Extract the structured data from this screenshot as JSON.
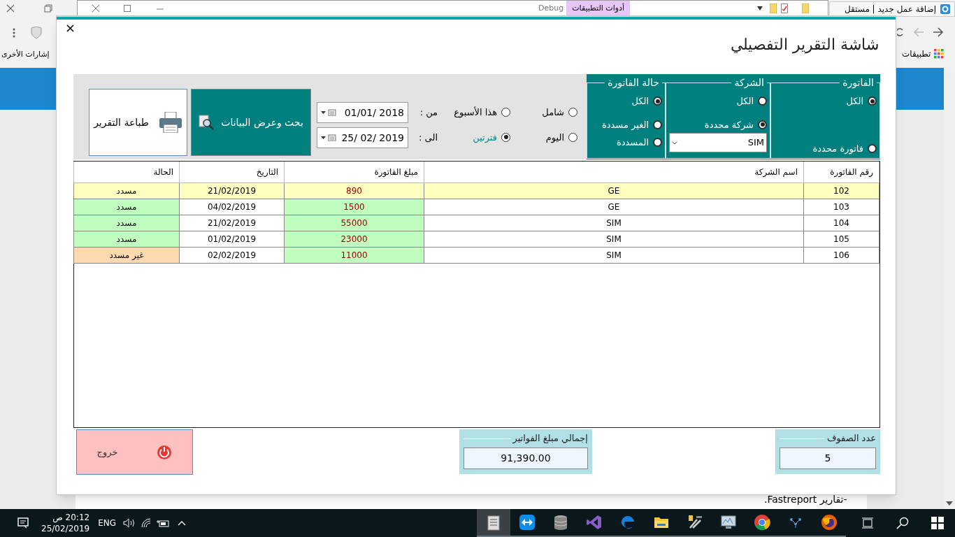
{
  "browser": {
    "tab_title": "إضافة عمل جديد | مستقل",
    "bookmarks": [
      {
        "label": "تطبيقات"
      },
      {
        "label": "إشارات الأخرى"
      }
    ]
  },
  "word": {
    "context_tab": "أدوات التطبيقات",
    "mode": "Debug",
    "document_text": "-تقارير Fastreport."
  },
  "dialog": {
    "title": "شاشة التقرير التفصيلي",
    "filter_groups": [
      {
        "title": "الفاتورة",
        "options": [
          {
            "label": "الكل",
            "selected": true
          },
          {
            "label": "فاتورة محددة",
            "selected": false
          }
        ]
      },
      {
        "title": "الشركة",
        "options": [
          {
            "label": "الكل",
            "selected": false
          },
          {
            "label": "شركة محددة",
            "selected": true
          }
        ],
        "dropdown": {
          "value": "SIM"
        }
      },
      {
        "title": "حالة الفاتورة",
        "options": [
          {
            "label": "الكل",
            "selected": true
          },
          {
            "label": "الغير مسددة",
            "selected": false
          },
          {
            "label": "المسددة",
            "selected": false
          }
        ]
      }
    ],
    "period_options": [
      {
        "label": "شامل",
        "selected": false
      },
      {
        "label": "هذا الأسبوع",
        "selected": false
      },
      {
        "label": "اليوم",
        "selected": false
      },
      {
        "label": "فترتين",
        "selected": true
      }
    ],
    "date_from": {
      "label": "من :",
      "value": "01/01/ 2018"
    },
    "date_to": {
      "label": "الى :",
      "value": "25/ 02/ 2019"
    },
    "search_button": "بحث وعرض البيانات",
    "print_button": "طباعة التقرير",
    "table": {
      "columns": [
        "رقم الفاتورة",
        "اسم الشركة",
        "مبلغ الفاتورة",
        "التاريخ",
        "الحالة"
      ],
      "rows": [
        {
          "cells": [
            "102",
            "GE",
            "890",
            "21/02/2019",
            "مسدد"
          ],
          "selected": true
        },
        {
          "cells": [
            "103",
            "GE",
            "1500",
            "04/02/2019",
            "مسدد"
          ],
          "selected": false,
          "color": "#c0ffc0"
        },
        {
          "cells": [
            "104",
            "SIM",
            "55000",
            "21/02/2019",
            "مسدد"
          ],
          "selected": false,
          "color": "#c0ffc0"
        },
        {
          "cells": [
            "105",
            "SIM",
            "23000",
            "01/02/2019",
            "مسدد"
          ],
          "selected": false,
          "color": "#c0ffc0"
        },
        {
          "cells": [
            "106",
            "SIM",
            "11000",
            "02/02/2019",
            "غير مسدد"
          ],
          "selected": false,
          "color": "#ffdab0"
        }
      ]
    },
    "row_count": {
      "label": "عدد الصفوف",
      "value": "5"
    },
    "total": {
      "label": "إجمالي مبلغ الفواتير",
      "value": "91,390.00"
    },
    "exit_button": "خروج"
  },
  "taskbar": {
    "time": "20:12 ص",
    "date": "25/02/2019",
    "language": "ENG"
  }
}
